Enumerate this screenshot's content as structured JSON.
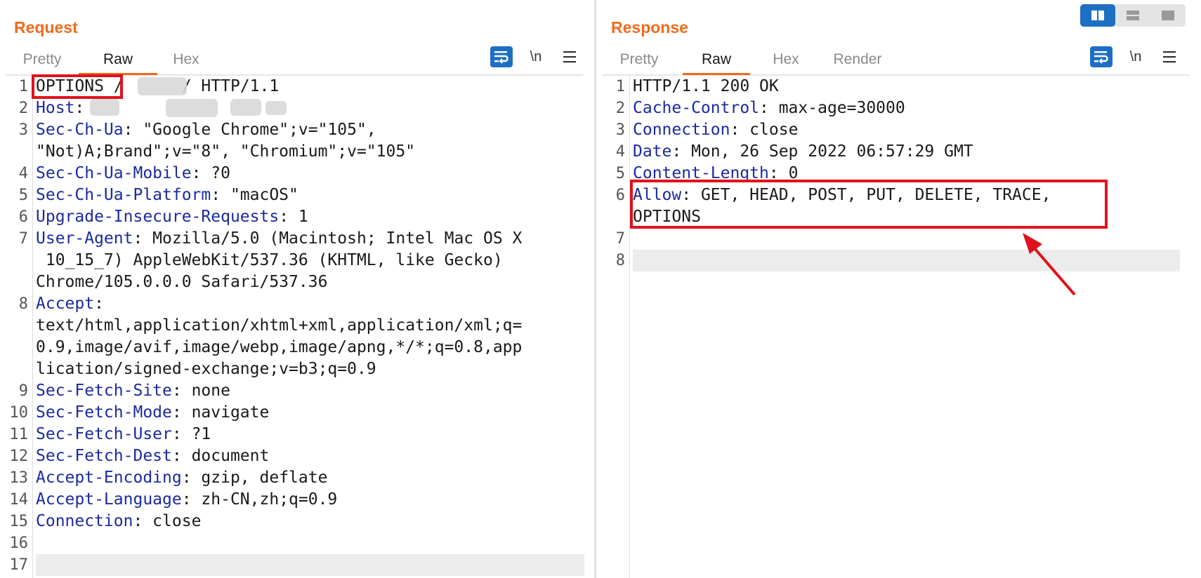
{
  "request": {
    "title": "Request",
    "tabs": [
      {
        "label": "Pretty",
        "active": false
      },
      {
        "label": "Raw",
        "active": true
      },
      {
        "label": "Hex",
        "active": false
      }
    ],
    "newline_toggle": "\\n",
    "lines": [
      {
        "num": "1",
        "key": "",
        "text": "OPTIONS /",
        "tail": "/ HTTP/1.1"
      },
      {
        "num": "2",
        "key": "Host",
        "text": ": "
      },
      {
        "num": "3",
        "key": "Sec-Ch-Ua",
        "text": ": \"Google Chrome\";v=\"105\","
      },
      {
        "num": "",
        "key": "",
        "text": "\"Not)A;Brand\";v=\"8\", \"Chromium\";v=\"105\""
      },
      {
        "num": "4",
        "key": "Sec-Ch-Ua-Mobile",
        "text": ": ?0"
      },
      {
        "num": "5",
        "key": "Sec-Ch-Ua-Platform",
        "text": ": \"macOS\""
      },
      {
        "num": "6",
        "key": "Upgrade-Insecure-Requests",
        "text": ": 1"
      },
      {
        "num": "7",
        "key": "User-Agent",
        "text": ": Mozilla/5.0 (Macintosh; Intel Mac OS X"
      },
      {
        "num": "",
        "key": "",
        "text": " 10_15_7) AppleWebKit/537.36 (KHTML, like Gecko)"
      },
      {
        "num": "",
        "key": "",
        "text": "Chrome/105.0.0.0 Safari/537.36"
      },
      {
        "num": "8",
        "key": "Accept",
        "text": ":"
      },
      {
        "num": "",
        "key": "",
        "text": "text/html,application/xhtml+xml,application/xml;q="
      },
      {
        "num": "",
        "key": "",
        "text": "0.9,image/avif,image/webp,image/apng,*/*;q=0.8,app"
      },
      {
        "num": "",
        "key": "",
        "text": "lication/signed-exchange;v=b3;q=0.9"
      },
      {
        "num": "9",
        "key": "Sec-Fetch-Site",
        "text": ": none"
      },
      {
        "num": "10",
        "key": "Sec-Fetch-Mode",
        "text": ": navigate"
      },
      {
        "num": "11",
        "key": "Sec-Fetch-User",
        "text": ": ?1"
      },
      {
        "num": "12",
        "key": "Sec-Fetch-Dest",
        "text": ": document"
      },
      {
        "num": "13",
        "key": "Accept-Encoding",
        "text": ": gzip, deflate"
      },
      {
        "num": "14",
        "key": "Accept-Language",
        "text": ": zh-CN,zh;q=0.9"
      },
      {
        "num": "15",
        "key": "Connection",
        "text": ": close"
      },
      {
        "num": "16",
        "key": "",
        "text": ""
      },
      {
        "num": "17",
        "key": "",
        "text": ""
      }
    ]
  },
  "response": {
    "title": "Response",
    "tabs": [
      {
        "label": "Pretty",
        "active": false
      },
      {
        "label": "Raw",
        "active": true
      },
      {
        "label": "Hex",
        "active": false
      },
      {
        "label": "Render",
        "active": false
      }
    ],
    "newline_toggle": "\\n",
    "lines": [
      {
        "num": "1",
        "key": "",
        "text": "HTTP/1.1 200 OK"
      },
      {
        "num": "2",
        "key": "Cache-Control",
        "text": ": max-age=30000"
      },
      {
        "num": "3",
        "key": "Connection",
        "text": ": close"
      },
      {
        "num": "4",
        "key": "Date",
        "text": ": Mon, 26 Sep 2022 06:57:29 GMT"
      },
      {
        "num": "5",
        "key": "Content-Length",
        "text": ": 0"
      },
      {
        "num": "6",
        "key": "Allow",
        "text": ": GET, HEAD, POST, PUT, DELETE, TRACE,"
      },
      {
        "num": "",
        "key": "",
        "text": "OPTIONS"
      },
      {
        "num": "7",
        "key": "",
        "text": ""
      },
      {
        "num": "8",
        "key": "",
        "text": ""
      }
    ]
  },
  "colors": {
    "accent": "#f26a1b",
    "header_key": "#1b2aa0",
    "highlight_box": "#e0121c",
    "button_blue": "#1e6fc4"
  },
  "icons": [
    "word-wrap-icon",
    "menu-icon",
    "layout-split-icon",
    "layout-horizontal-icon",
    "layout-single-icon",
    "red-arrow-icon"
  ]
}
